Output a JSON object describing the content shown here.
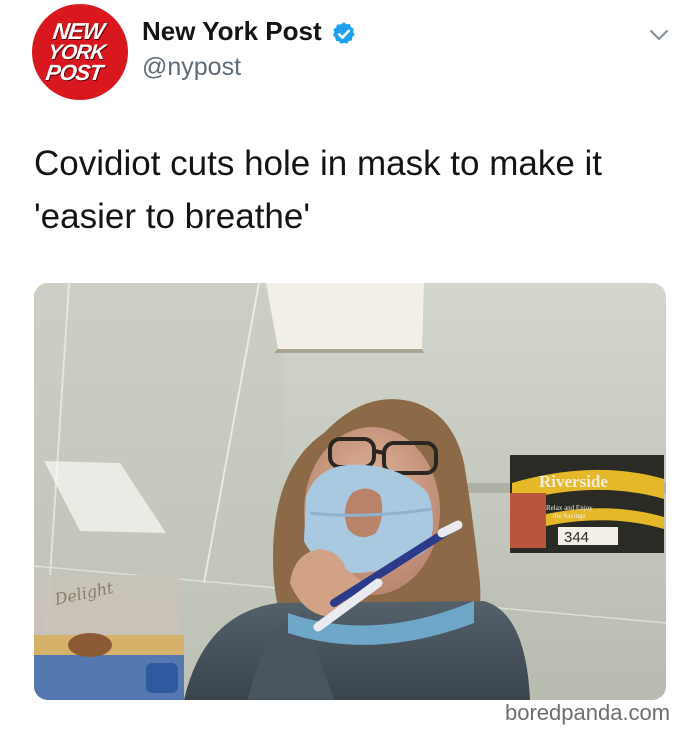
{
  "account": {
    "display_name": "New York Post",
    "handle": "@nypost",
    "verified": true,
    "avatar_logo_lines": [
      "NEW",
      "YORK",
      "POST"
    ],
    "avatar_color": "#d9171e",
    "verified_color": "#1da1f2"
  },
  "tweet": {
    "text_lines": [
      "Covidiot cuts hole in mask to make it",
      "'easier to breathe'"
    ]
  },
  "media": {
    "sign_lines": [
      "Riverside",
      "Relax and Enjoy",
      "the Savings",
      "344"
    ],
    "box_text": "Delight"
  },
  "icons": {
    "menu": "chevron-down-icon",
    "verified": "verified-badge-icon"
  },
  "watermark": "boredpanda.com"
}
